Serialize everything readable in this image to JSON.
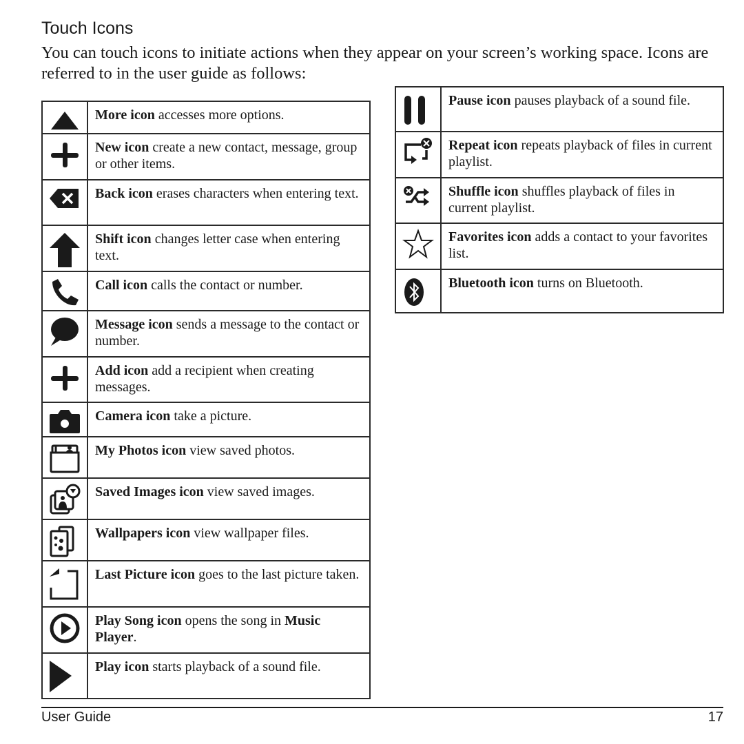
{
  "page": {
    "title": "Touch Icons",
    "intro": "You can touch icons to initiate actions when they appear on your screen’s working space. Icons are referred to in the user guide as follows:"
  },
  "left_table": [
    {
      "icon": "more-icon",
      "name": "More icon",
      "desc": " accesses more options.",
      "extra_bold": "",
      "extra_tail": ""
    },
    {
      "icon": "new-icon",
      "name": "New icon",
      "desc": " create a new contact, message, group or other items.",
      "extra_bold": "",
      "extra_tail": ""
    },
    {
      "icon": "back-icon",
      "name": "Back icon",
      "desc": " erases characters when entering text.",
      "extra_bold": "",
      "extra_tail": ""
    },
    {
      "icon": "shift-icon",
      "name": "Shift icon",
      "desc": " changes letter case when entering text.",
      "extra_bold": "",
      "extra_tail": ""
    },
    {
      "icon": "call-icon",
      "name": "Call icon",
      "desc": " calls the contact or number.",
      "extra_bold": "",
      "extra_tail": ""
    },
    {
      "icon": "message-icon",
      "name": "Message icon",
      "desc": " sends a message to the contact or number.",
      "extra_bold": "",
      "extra_tail": ""
    },
    {
      "icon": "add-icon",
      "name": "Add icon",
      "desc": " add a recipient when creating messages.",
      "extra_bold": "",
      "extra_tail": ""
    },
    {
      "icon": "camera-icon",
      "name": "Camera icon",
      "desc": " take a picture.",
      "extra_bold": "",
      "extra_tail": ""
    },
    {
      "icon": "my-photos-icon",
      "name": "My Photos icon",
      "desc": " view saved photos.",
      "extra_bold": "",
      "extra_tail": ""
    },
    {
      "icon": "saved-images-icon",
      "name": "Saved Images icon",
      "desc": " view saved images.",
      "extra_bold": "",
      "extra_tail": ""
    },
    {
      "icon": "wallpapers-icon",
      "name": "Wallpapers icon",
      "desc": " view wallpaper files.",
      "extra_bold": "",
      "extra_tail": ""
    },
    {
      "icon": "last-picture-icon",
      "name": "Last Picture icon",
      "desc": " goes to the last picture taken.",
      "extra_bold": "",
      "extra_tail": ""
    },
    {
      "icon": "play-song-icon",
      "name": "Play Song icon",
      "desc": " opens the song in ",
      "extra_bold": "Music Player",
      "extra_tail": "."
    },
    {
      "icon": "play-icon",
      "name": "Play icon",
      "desc": " starts playback of a sound file.",
      "extra_bold": "",
      "extra_tail": ""
    }
  ],
  "right_table": [
    {
      "icon": "pause-icon",
      "name": "Pause icon",
      "desc": " pauses playback of a sound file."
    },
    {
      "icon": "repeat-icon",
      "name": "Repeat icon",
      "desc": " repeats playback of files in current playlist."
    },
    {
      "icon": "shuffle-icon",
      "name": "Shuffle icon",
      "desc": " shuffles playback of files in current playlist."
    },
    {
      "icon": "favorites-icon",
      "name": "Favorites icon",
      "desc": " adds a contact to your favorites list."
    },
    {
      "icon": "bluetooth-icon",
      "name": "Bluetooth icon",
      "desc": " turns on Bluetooth."
    }
  ],
  "footer": {
    "left": "User Guide",
    "page_number": "17"
  }
}
